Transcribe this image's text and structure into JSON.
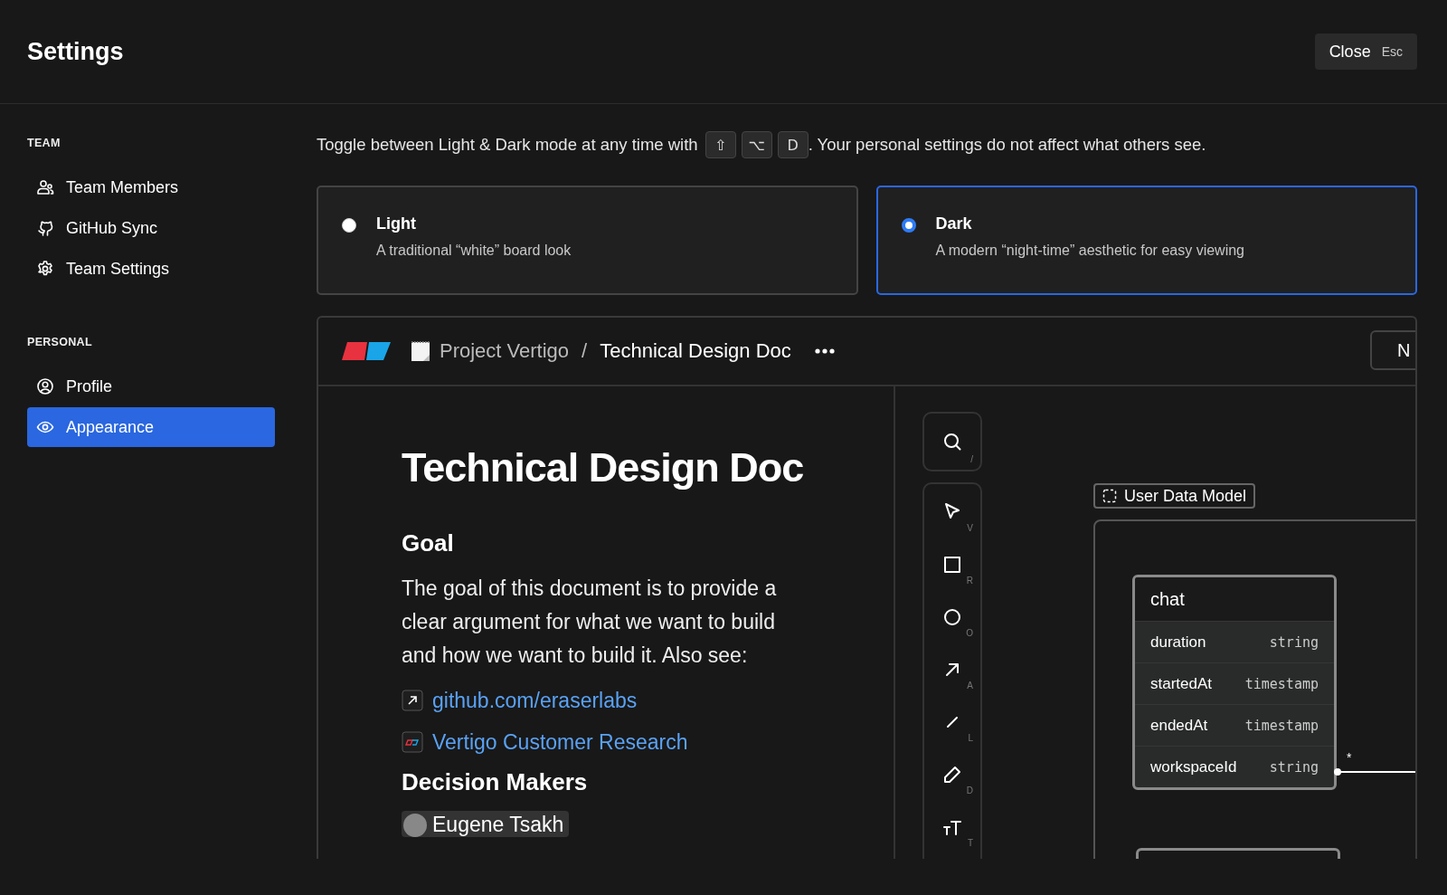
{
  "header": {
    "title": "Settings",
    "close_button": {
      "label": "Close",
      "shortcut": "Esc"
    }
  },
  "sidebar": {
    "sections": [
      {
        "heading": "TEAM",
        "items": [
          {
            "label": "Team Members",
            "kind": "members",
            "selected": false
          },
          {
            "label": "GitHub Sync",
            "kind": "github",
            "selected": false
          },
          {
            "label": "Team Settings",
            "kind": "gear",
            "selected": false
          }
        ]
      },
      {
        "heading": "PERSONAL",
        "items": [
          {
            "label": "Profile",
            "kind": "profile",
            "selected": false
          },
          {
            "label": "Appearance",
            "kind": "eye",
            "selected": true
          }
        ]
      }
    ]
  },
  "hint": {
    "before": "Toggle between Light & Dark mode at any time with",
    "keys": [
      "⇧",
      "⌥",
      "D"
    ],
    "after": ". Your personal settings do not affect what others see."
  },
  "theme_options": [
    {
      "label": "Light",
      "description": "A traditional “white” board look",
      "selected": false
    },
    {
      "label": "Dark",
      "description": "A modern “night-time” aesthetic for easy viewing",
      "selected": true
    }
  ],
  "preview": {
    "breadcrumb": {
      "project": "Project Vertigo",
      "separator": "/",
      "page": "Technical Design Doc"
    },
    "header_button": "N",
    "document": {
      "title": "Technical Design Doc",
      "blocks": [
        {
          "kind": "heading",
          "text": "Goal"
        },
        {
          "kind": "paragraph",
          "text": "The goal of this document is to provide a clear argument for what we want to build and how we want to build it. Also see:"
        },
        {
          "kind": "external_link",
          "text": "github.com/eraserlabs"
        },
        {
          "kind": "file_link",
          "text": "Vertigo Customer Research"
        },
        {
          "kind": "heading",
          "text": "Decision Makers"
        },
        {
          "kind": "person",
          "text": "Eugene Tsakh"
        }
      ]
    },
    "toolbar": [
      {
        "kind": "search",
        "shortcut": "/"
      },
      {
        "kind": "pointer",
        "shortcut": "V"
      },
      {
        "kind": "rectangle",
        "shortcut": "R"
      },
      {
        "kind": "circle",
        "shortcut": "O"
      },
      {
        "kind": "arrow",
        "shortcut": "A"
      },
      {
        "kind": "line",
        "shortcut": "L"
      },
      {
        "kind": "pencil",
        "shortcut": "D"
      },
      {
        "kind": "text",
        "shortcut": "T"
      }
    ],
    "canvas": {
      "group_label": "User Data Model",
      "entity": {
        "name": "chat",
        "fields": [
          {
            "name": "duration",
            "type": "string"
          },
          {
            "name": "startedAt",
            "type": "timestamp"
          },
          {
            "name": "endedAt",
            "type": "timestamp"
          },
          {
            "name": "workspaceId",
            "type": "string"
          }
        ]
      },
      "relation_label": "*"
    }
  }
}
